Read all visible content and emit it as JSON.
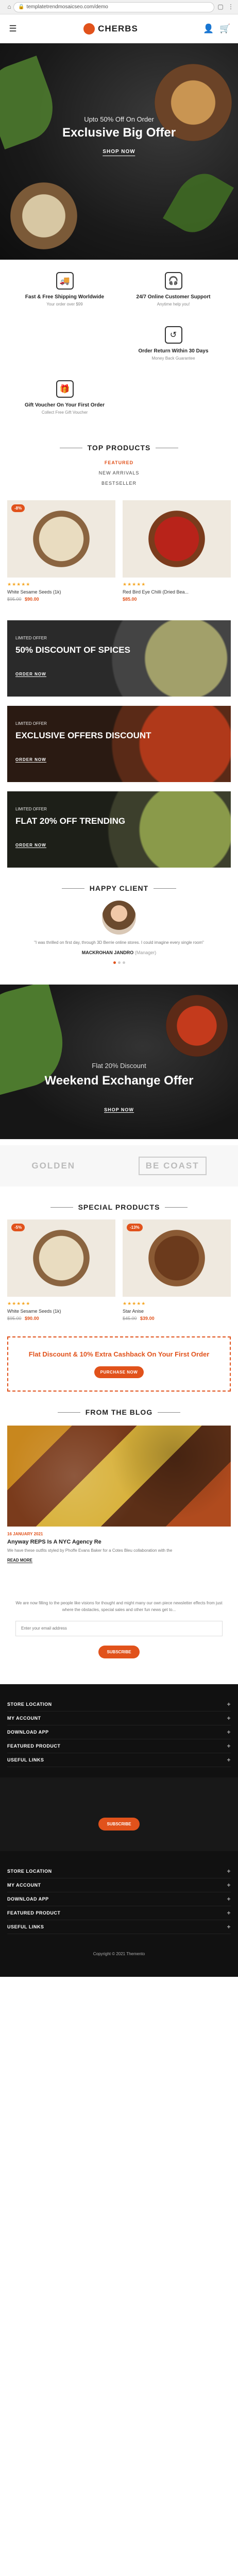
{
  "browser": {
    "url": "templatetrendmosaicseo.com/demo"
  },
  "header": {
    "logo": "CHERBS"
  },
  "hero": {
    "subtitle": "Upto 50% Off On Order",
    "title": "Exclusive Big Offer",
    "button": "SHOP NOW"
  },
  "features": [
    {
      "title": "Fast & Free Shipping Worldwide",
      "desc": "Your order over $99",
      "icon": "truck-icon"
    },
    {
      "title": "24/7 Online Customer Support",
      "desc": "Anytime help you!",
      "icon": "headset-icon"
    },
    {
      "title": "Order Return Within 30 Days",
      "desc": "Money Back Guarantee",
      "icon": "return-icon"
    },
    {
      "title": "Gift Voucher On Your First Order",
      "desc": "Collect Free Gift Voucher",
      "icon": "gift-icon"
    }
  ],
  "top_products": {
    "title": "TOP PRODUCTS",
    "tabs": [
      "FEATURED",
      "NEW ARRIVALS",
      "BESTSELLER"
    ],
    "items": [
      {
        "badge": "-8%",
        "name": "White Sesame Seeds (1k)",
        "old": "$95.00",
        "price": "$90.00",
        "stars": "★★★★★"
      },
      {
        "badge": "",
        "name": "Red Bird Eye Chilli (Dried Bea...",
        "old": "",
        "price": "$85.00",
        "stars": "★★★★★"
      }
    ]
  },
  "banners": [
    {
      "label": "LIMITED OFFER",
      "title": "50% DISCOUNT OF SPICES",
      "button": "ORDER NOW"
    },
    {
      "label": "LIMITED OFFER",
      "title": "EXCLUSIVE OFFERS DISCOUNT",
      "button": "ORDER NOW"
    },
    {
      "label": "LIMITED OFFER",
      "title": "FLAT 20% OFF TRENDING",
      "button": "ORDER NOW"
    }
  ],
  "testimonial": {
    "title": "HAPPY CLIENT",
    "quote": "\"I was thrilled on first day, through 3D Berrie online stores. I could imagine every single room\"",
    "author": "MACKROHAN JANDRO",
    "role": "(Manager)"
  },
  "exchange": {
    "subtitle": "Flat 20% Discount",
    "title": "Weekend Exchange Offer",
    "button": "SHOP NOW"
  },
  "brands": [
    "GOLDEN",
    "BE COAST"
  ],
  "special_products": {
    "title": "SPECIAL PRODUCTS",
    "items": [
      {
        "badge": "-5%",
        "name": "White Sesame Seeds (1k)",
        "old": "$95.00",
        "price": "$90.00",
        "stars": "★★★★★"
      },
      {
        "badge": "-13%",
        "name": "Star Anise",
        "old": "$45.00",
        "price": "$39.00",
        "stars": "★★★★★"
      }
    ]
  },
  "promo": {
    "title": "Flat Discount & 10% Extra Cashback On Your First Order",
    "button": "PURCHASE NOW"
  },
  "blog": {
    "title": "FROM THE BLOG",
    "date": "16 JANUARY 2021",
    "post_title": "Anyway REPS Is A NYC Agency Re",
    "text": "We have these outfits styled by Phoffe Evans Baker for a Cotes Bleu collaboration with the",
    "more": "READ MORE"
  },
  "newsletter": {
    "text": "We are now filling to the people like visions for thought and might many our own piece newsletter effects from just where the obstacles, special sales and other fun news get to...",
    "placeholder": "Enter your email address",
    "button": "SUBSCRIBE"
  },
  "footer_links_1": [
    "STORE LOCATION",
    "MY ACCOUNT",
    "DOWNLOAD APP",
    "FEATURED PRODUCT",
    "USEFUL LINKS"
  ],
  "footer_mid_button": "SUBSCRIBE",
  "footer_links_2": [
    "STORE LOCATION",
    "MY ACCOUNT",
    "DOWNLOAD APP",
    "FEATURED PRODUCT",
    "USEFUL LINKS"
  ],
  "copyright": "Copyright © 2021 Themento"
}
